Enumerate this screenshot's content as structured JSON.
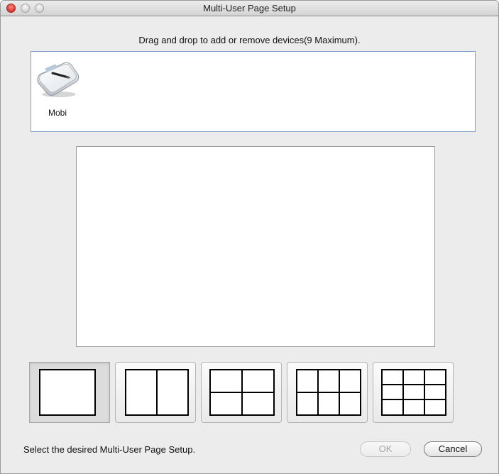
{
  "window": {
    "title": "Multi-User Page Setup"
  },
  "instruction": "Drag and drop to add or remove devices(9 Maximum).",
  "devices": [
    {
      "label": "Mobi",
      "icon": "tablet-device-icon"
    }
  ],
  "layouts": [
    {
      "name": "single",
      "panes": 1,
      "selected": true
    },
    {
      "name": "two-vertical",
      "panes": 2,
      "selected": false
    },
    {
      "name": "four-grid",
      "panes": 4,
      "selected": false
    },
    {
      "name": "six-grid",
      "panes": 6,
      "selected": false
    },
    {
      "name": "nine-grid",
      "panes": 9,
      "selected": false
    }
  ],
  "footer": {
    "status": "Select the desired Multi-User Page Setup.",
    "ok_label": "OK",
    "ok_enabled": false,
    "cancel_label": "Cancel"
  }
}
